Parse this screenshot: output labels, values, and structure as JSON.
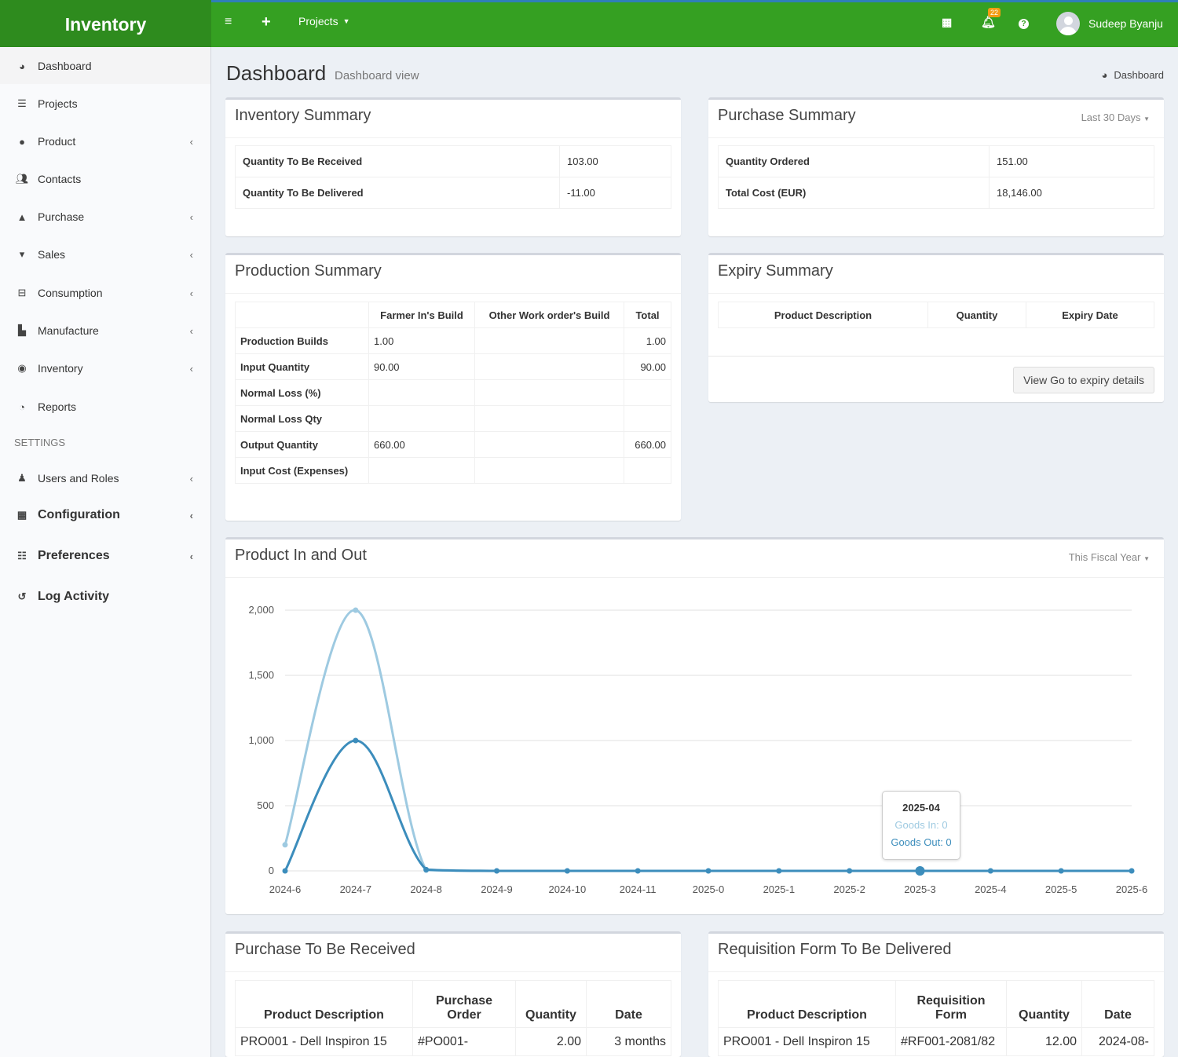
{
  "app": {
    "brand": "Inventory"
  },
  "topbar": {
    "menu_icon": "hamburger-icon",
    "add_icon": "plus-icon",
    "projects_label": "Projects",
    "notification_count": "22",
    "user_name": "Sudeep Byanju"
  },
  "sidebar": {
    "items": [
      {
        "label": "Dashboard",
        "icon": "dashboard-icon"
      },
      {
        "label": "Projects",
        "icon": "list-icon"
      },
      {
        "label": "Product",
        "icon": "product-icon"
      },
      {
        "label": "Contacts",
        "icon": "users-icon"
      },
      {
        "label": "Purchase",
        "icon": "bag-icon"
      },
      {
        "label": "Sales",
        "icon": "cart-icon"
      },
      {
        "label": "Consumption",
        "icon": "basket-icon"
      },
      {
        "label": "Manufacture",
        "icon": "factory-icon"
      },
      {
        "label": "Inventory",
        "icon": "user-circle-icon"
      },
      {
        "label": "Reports",
        "icon": "pie-chart-icon"
      }
    ],
    "settings_header": "SETTINGS",
    "settings_items": [
      {
        "label": "Users and Roles",
        "icon": "user-icon"
      },
      {
        "label": "Configuration",
        "icon": "grid-icon"
      },
      {
        "label": "Preferences",
        "icon": "sliders-icon"
      },
      {
        "label": "Log Activity",
        "icon": "history-icon"
      }
    ]
  },
  "page": {
    "title": "Dashboard",
    "subtitle": "Dashboard view",
    "breadcrumb": "Dashboard"
  },
  "inventory_summary": {
    "title": "Inventory Summary",
    "rows": [
      {
        "label": "Quantity To Be Received",
        "value": "103.00"
      },
      {
        "label": "Quantity To Be Delivered",
        "value": "-11.00"
      }
    ]
  },
  "purchase_summary": {
    "title": "Purchase Summary",
    "period": "Last 30 Days",
    "rows": [
      {
        "label": "Quantity Ordered",
        "value": "151.00"
      },
      {
        "label": "Total Cost (EUR)",
        "value": "18,146.00"
      }
    ]
  },
  "production_summary": {
    "title": "Production Summary",
    "headers": [
      "",
      "Farmer In's Build",
      "Other Work order's Build",
      "Total"
    ],
    "rows": [
      [
        "Production Builds",
        "1.00",
        "",
        "1.00"
      ],
      [
        "Input Quantity",
        "90.00",
        "",
        "90.00"
      ],
      [
        "Normal Loss (%)",
        "",
        "",
        ""
      ],
      [
        "Normal Loss Qty",
        "",
        "",
        ""
      ],
      [
        "Output Quantity",
        "660.00",
        "",
        "660.00"
      ],
      [
        "Input Cost (Expenses)",
        "",
        "",
        ""
      ]
    ]
  },
  "expiry_summary": {
    "title": "Expiry Summary",
    "headers": [
      "Product Description",
      "Quantity",
      "Expiry Date"
    ],
    "button": "View Go to expiry details"
  },
  "product_in_out": {
    "title": "Product In and Out",
    "period": "This Fiscal Year",
    "tooltip": {
      "title": "2025-04",
      "goods_in": "Goods In: 0",
      "goods_out": "Goods Out: 0"
    }
  },
  "chart_data": {
    "type": "line",
    "categories": [
      "2024-6",
      "2024-7",
      "2024-8",
      "2024-9",
      "2024-10",
      "2024-11",
      "2025-0",
      "2025-1",
      "2025-2",
      "2025-3",
      "2025-4",
      "2025-5",
      "2025-6"
    ],
    "series": [
      {
        "name": "Goods In",
        "color": "#9ecae1",
        "values": [
          200,
          2000,
          5,
          0,
          0,
          0,
          0,
          0,
          0,
          0,
          0,
          0,
          0
        ]
      },
      {
        "name": "Goods Out",
        "color": "#3c8dbc",
        "values": [
          0,
          1000,
          10,
          0,
          0,
          0,
          0,
          0,
          0,
          0,
          0,
          0,
          0
        ]
      }
    ],
    "yticks": [
      "0",
      "500",
      "1,000",
      "1,500",
      "2,000"
    ],
    "ylim": [
      0,
      2000
    ],
    "grid": true
  },
  "purchase_to_be_received": {
    "title": "Purchase To Be Received",
    "headers": [
      "Product Description",
      "Purchase Order",
      "Quantity",
      "Date"
    ],
    "rows": [
      [
        "PRO001 - Dell Inspiron 15",
        "#PO001-",
        "2.00",
        "3 months"
      ]
    ]
  },
  "requisition_to_be_delivered": {
    "title": "Requisition Form To Be Delivered",
    "headers": [
      "Product Description",
      "Requisition Form",
      "Quantity",
      "Date"
    ],
    "rows": [
      [
        "PRO001 - Dell Inspiron 15",
        "#RF001-2081/82",
        "12.00",
        "2024-08-"
      ]
    ]
  }
}
